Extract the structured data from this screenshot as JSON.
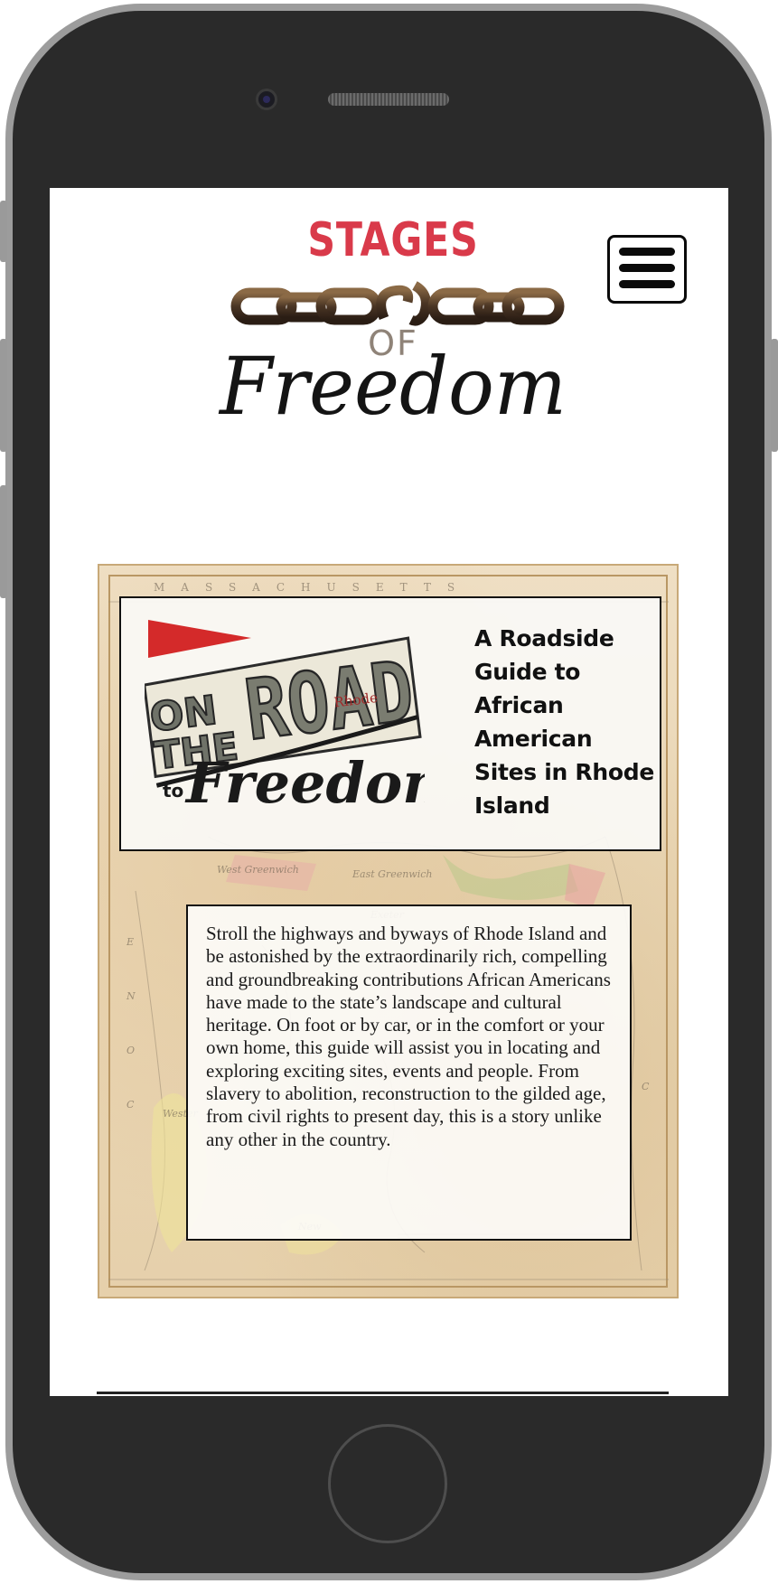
{
  "header": {
    "logo": {
      "line1": "STAGES",
      "line2": "OF",
      "line3": "Freedom"
    },
    "menu_button_icon": "hamburger-menu-icon"
  },
  "hero": {
    "road_logo": {
      "word_on": "ON",
      "word_the": "THE",
      "word_road": "ROAD",
      "word_rhode": "Rhode",
      "word_to": "to",
      "word_freedom": "Freedom"
    },
    "heading": "A Roadside Guide to African American Sites in Rhode Island"
  },
  "intro": {
    "text": "Stroll the highways and byways of Rhode Island and be astonished by the extraordinarily rich, compelling and groundbreaking contributions African Americans have made to the state’s landscape and cultural heritage. On foot or by car, or in the comfort or your own home, this guide will assist you in locating and exploring exciting sites, events and people. From slavery to abolition, reconstruction to the gilded age, from civil rights to present day, this is a story unlike any other in the country."
  },
  "colors": {
    "brand_red": "#d93a4a",
    "pennant_red": "#d42a2a",
    "map_parchment": "#ead7b6"
  }
}
